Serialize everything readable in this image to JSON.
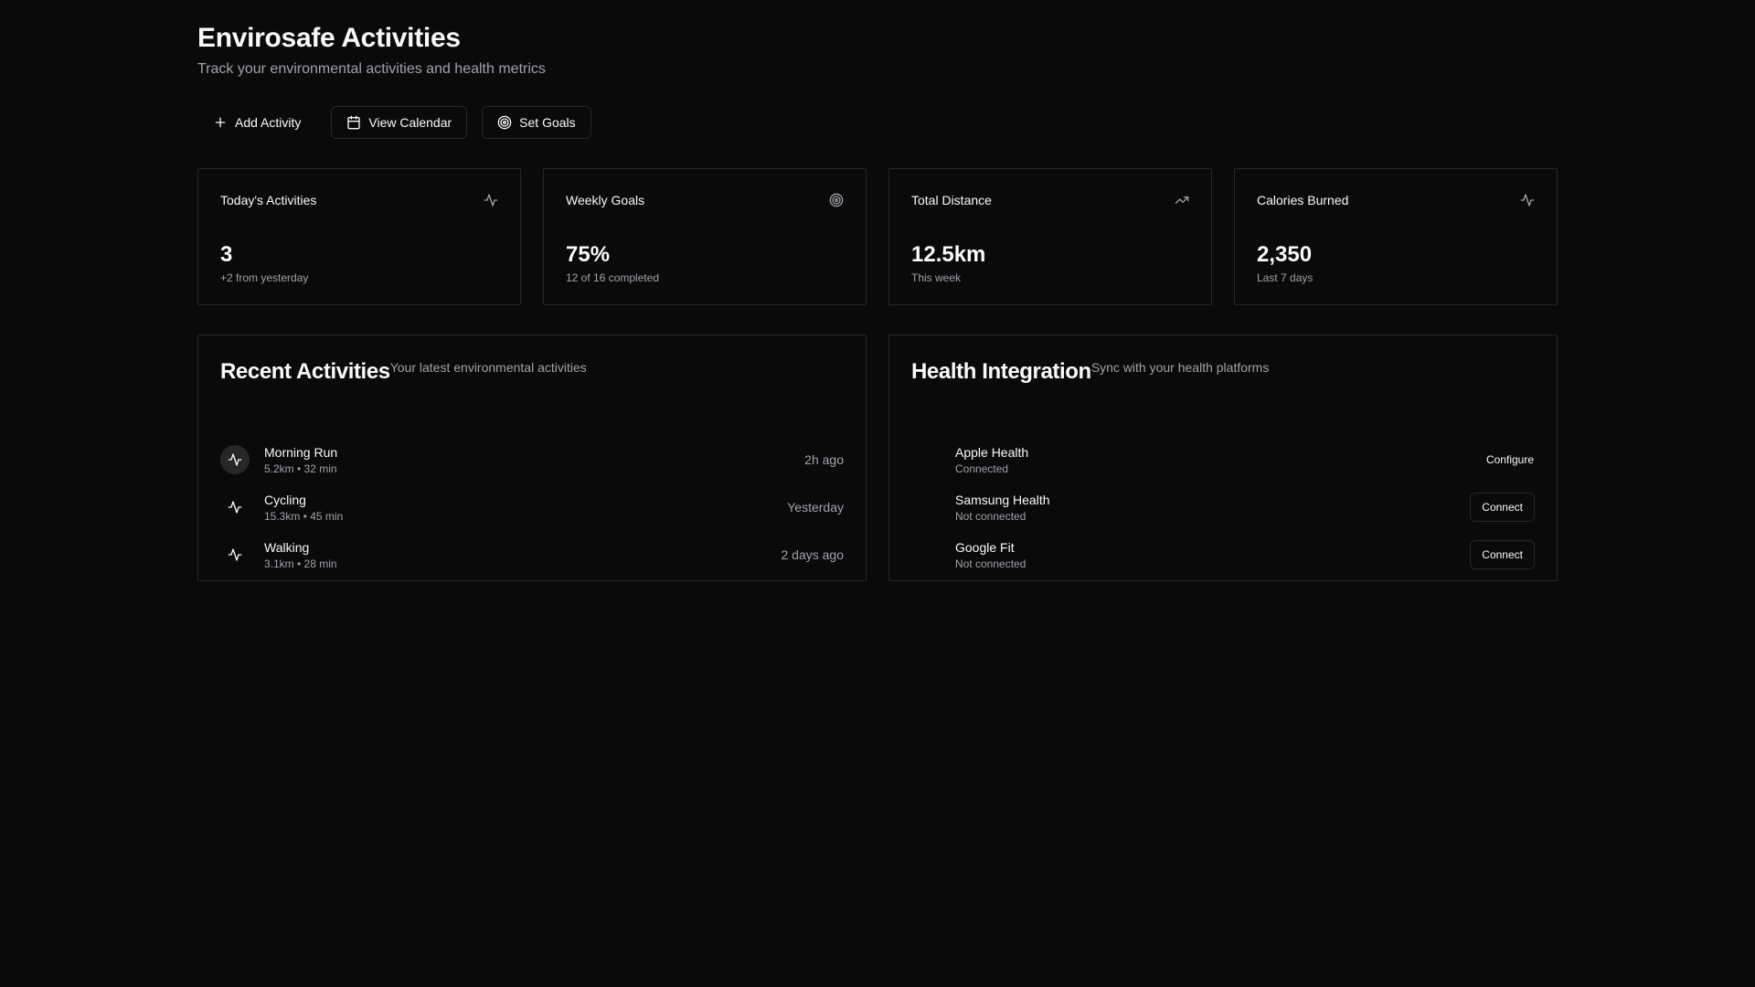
{
  "header": {
    "title": "Envirosafe Activities",
    "subtitle": "Track your environmental activities and health metrics"
  },
  "actions": {
    "add_label": "Add Activity",
    "calendar_label": "View Calendar",
    "goals_label": "Set Goals"
  },
  "stats": [
    {
      "label": "Today's Activities",
      "value": "3",
      "note": "+2 from yesterday",
      "icon": "activity-icon"
    },
    {
      "label": "Weekly Goals",
      "value": "75%",
      "note": "12 of 16 completed",
      "icon": "target-icon"
    },
    {
      "label": "Total Distance",
      "value": "12.5km",
      "note": "This week",
      "icon": "trending-up-icon"
    },
    {
      "label": "Calories Burned",
      "value": "2,350",
      "note": "Last 7 days",
      "icon": "activity-icon"
    }
  ],
  "recent": {
    "title": "Recent Activities",
    "description": "Your latest environmental activities",
    "items": [
      {
        "name": "Morning Run",
        "detail": "5.2km • 32 min",
        "time": "2h ago"
      },
      {
        "name": "Cycling",
        "detail": "15.3km • 45 min",
        "time": "Yesterday"
      },
      {
        "name": "Walking",
        "detail": "3.1km • 28 min",
        "time": "2 days ago"
      }
    ]
  },
  "health": {
    "title": "Health Integration",
    "description": "Sync with your health platforms",
    "items": [
      {
        "name": "Apple Health",
        "status": "Connected",
        "action": "Configure"
      },
      {
        "name": "Samsung Health",
        "status": "Not connected",
        "action": "Connect"
      },
      {
        "name": "Google Fit",
        "status": "Not connected",
        "action": "Connect"
      }
    ]
  },
  "colors": {
    "background": "#0a0a0a",
    "border": "#27272a",
    "text": "#fafafa",
    "muted": "#a1a1aa"
  }
}
